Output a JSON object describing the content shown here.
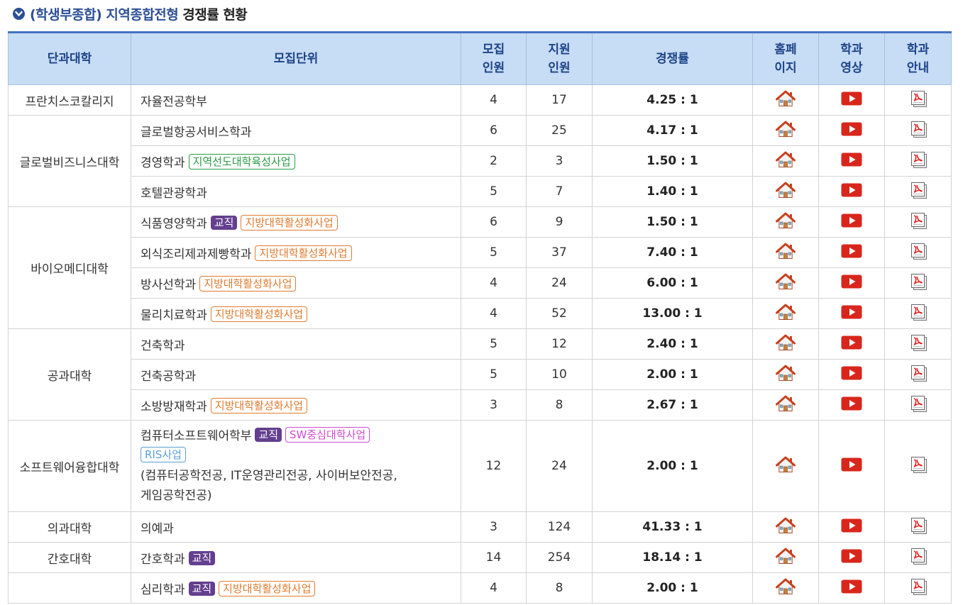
{
  "title": {
    "blue": "(학생부종합) 지역종합전형",
    "black": "경쟁률 현황"
  },
  "headers": {
    "college": "단과대학",
    "unit": "모집단위",
    "quota_l1": "모집",
    "quota_l2": "인원",
    "applicants_l1": "지원",
    "applicants_l2": "인원",
    "rate": "경쟁률",
    "homepage_l1": "홈페",
    "homepage_l2": "이지",
    "video_l1": "학과",
    "video_l2": "영상",
    "guide_l1": "학과",
    "guide_l2": "안내"
  },
  "colleges": {
    "c0": "프란치스코칼리지",
    "c1": "글로벌비즈니스대학",
    "c2": "바이오메디대학",
    "c3": "공과대학",
    "c4": "소프트웨어융합대학",
    "c5": "의과대학",
    "c6": "간호대학"
  },
  "badges": {
    "kyojik": "교직",
    "regional_leading": "지역선도대학육성사업",
    "local_activation": "지방대학활성화사업",
    "sw_center": "SW중심대학사업",
    "ris": "RIS사업"
  },
  "rows": [
    {
      "unit": "자율전공학부",
      "quota": "4",
      "applicants": "17",
      "rate": "4.25 : 1"
    },
    {
      "unit": "글로벌항공서비스학과",
      "quota": "6",
      "applicants": "25",
      "rate": "4.17 : 1"
    },
    {
      "unit": "경영학과",
      "quota": "2",
      "applicants": "3",
      "rate": "1.50 : 1"
    },
    {
      "unit": "호텔관광학과",
      "quota": "5",
      "applicants": "7",
      "rate": "1.40 : 1"
    },
    {
      "unit": "식품영양학과",
      "quota": "6",
      "applicants": "9",
      "rate": "1.50 : 1"
    },
    {
      "unit": "외식조리제과제빵학과",
      "quota": "5",
      "applicants": "37",
      "rate": "7.40 : 1"
    },
    {
      "unit": "방사선학과",
      "quota": "4",
      "applicants": "24",
      "rate": "6.00 : 1"
    },
    {
      "unit": "물리치료학과",
      "quota": "4",
      "applicants": "52",
      "rate": "13.00 : 1"
    },
    {
      "unit": "건축학과",
      "quota": "5",
      "applicants": "12",
      "rate": "2.40 : 1"
    },
    {
      "unit": "건축공학과",
      "quota": "5",
      "applicants": "10",
      "rate": "2.00 : 1"
    },
    {
      "unit": "소방방재학과",
      "quota": "3",
      "applicants": "8",
      "rate": "2.67 : 1"
    },
    {
      "unit": "컴퓨터소프트웨어학부",
      "unit_note_1": "(컴퓨터공학전공, IT운영관리전공, 사이버보안전공,",
      "unit_note_2": "게임공학전공)",
      "quota": "12",
      "applicants": "24",
      "rate": "2.00 : 1"
    },
    {
      "unit": "의예과",
      "quota": "3",
      "applicants": "124",
      "rate": "41.33 : 1"
    },
    {
      "unit": "간호학과",
      "quota": "14",
      "applicants": "254",
      "rate": "18.14 : 1"
    },
    {
      "unit": "심리학과",
      "quota": "4",
      "applicants": "8",
      "rate": "2.00 : 1"
    }
  ],
  "icons": {
    "homepage": "home-icon",
    "video": "video-play-icon",
    "guide": "pdf-document-icon"
  },
  "colors": {
    "title_blue": "#2d4f96",
    "header_bg": "#c7dcf5",
    "header_text": "#1d4386",
    "table_top_border": "#4472c4",
    "badge_kyojik": "#643f8f",
    "badge_green": "#2a9a45",
    "badge_orange": "#e07b2f",
    "badge_pink": "#d14cd1",
    "badge_blue": "#5b9fd8",
    "video_red": "#d9261c"
  }
}
